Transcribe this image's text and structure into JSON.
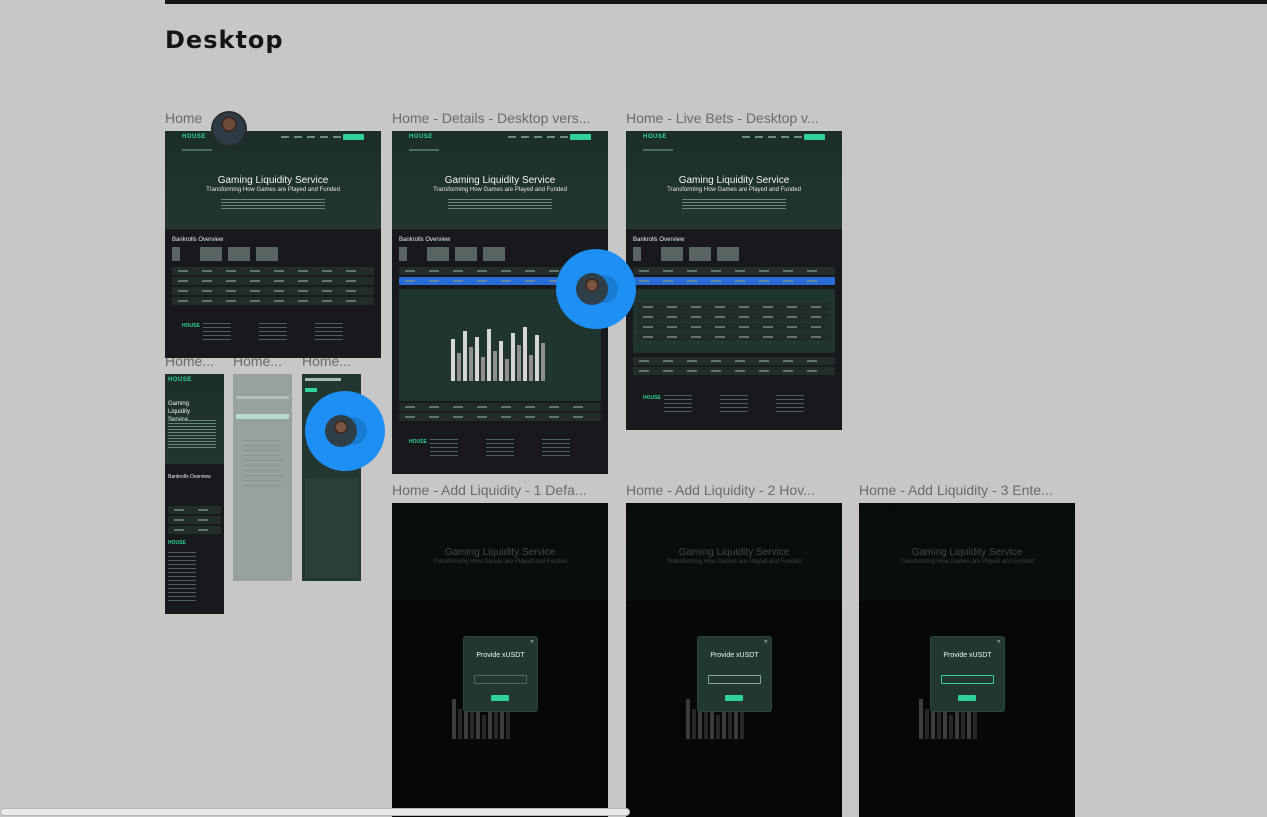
{
  "section": {
    "title": "Desktop"
  },
  "frames": {
    "home": {
      "label": "Home"
    },
    "home_details": {
      "label": "Home - Details - Desktop vers..."
    },
    "home_live_bets": {
      "label": "Home - Live Bets - Desktop v..."
    },
    "mobile_1": {
      "label": "Home..."
    },
    "mobile_2": {
      "label": "Home..."
    },
    "mobile_3": {
      "label": "Home..."
    },
    "add_liq_1": {
      "label": "Home - Add Liquidity - 1 Defa..."
    },
    "add_liq_2": {
      "label": "Home - Add Liquidity - 2 Hov..."
    },
    "add_liq_3": {
      "label": "Home - Add Liquidity - 3 Ente..."
    }
  },
  "page": {
    "logo": "HOUSE",
    "hero_title": "Gaming Liquidity Service",
    "hero_subtitle": "Transforming How Games are Played and Funded",
    "bankrolls_title": "Bankrolls Overview",
    "modal_title": "Provide xUSDT"
  },
  "colors": {
    "accent": "#2fd39a",
    "collab_bubble": "#1e90f5",
    "canvas": "#c7c7c7"
  }
}
